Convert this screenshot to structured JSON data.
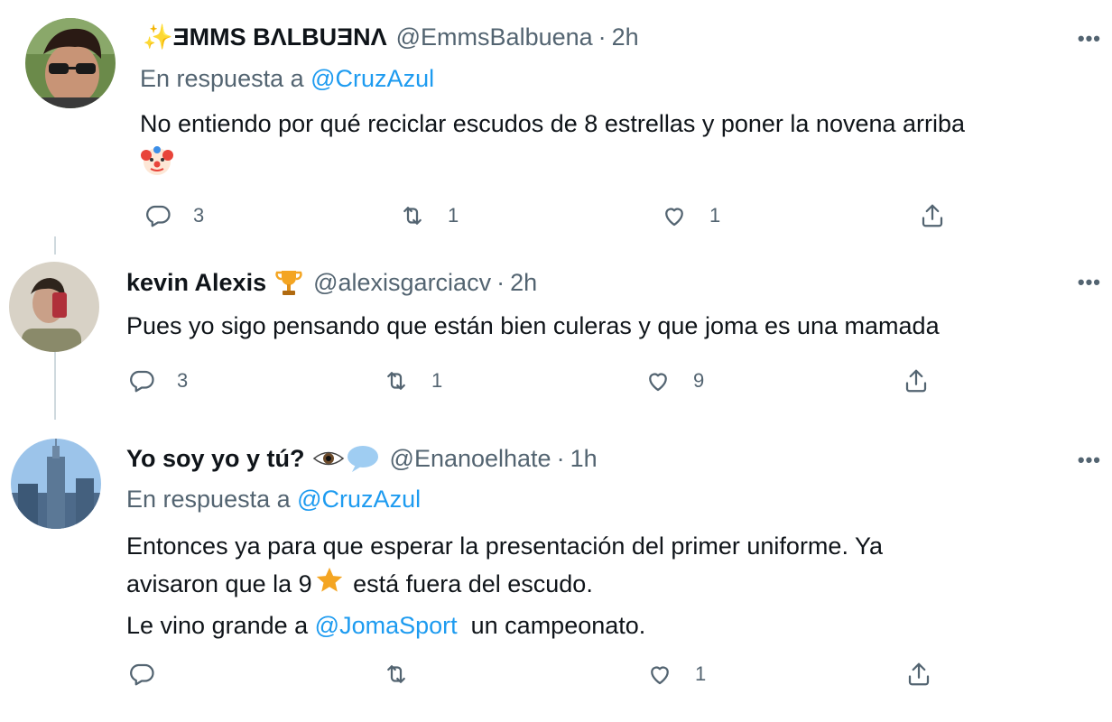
{
  "tweets": [
    {
      "display_name": "✨ƎMMS BΛLBUƎNΛ",
      "handle": "@EmmsBalbuena",
      "time": "2h",
      "replying_prefix": "En respuesta a",
      "replying_to": "@CruzAzul",
      "text_line1": "No entiendo por qué reciclar escudos de 8 estrellas y poner la novena arriba",
      "emoji": "clown-face",
      "replies": "3",
      "retweets": "1",
      "likes": "1"
    },
    {
      "display_name": "kevin Alexis",
      "name_emoji": "trophy",
      "handle": "@alexisgarciacv",
      "time": "2h",
      "text_line1": "Pues yo sigo pensando que están bien culeras y que joma es una mamada",
      "replies": "3",
      "retweets": "1",
      "likes": "9"
    },
    {
      "display_name": "Yo soy yo y tú?",
      "name_emoji": "eye-in-speech-bubble",
      "handle": "@Enanoelhate",
      "time": "1h",
      "replying_prefix": "En respuesta a",
      "replying_to": "@CruzAzul",
      "text_line1": "Entonces ya para que esperar la presentación del primer uniforme. Ya",
      "text_line2a": "avisaron que la 9",
      "text_line2b": " está fuera del escudo.",
      "text_line3a": "Le vino grande a ",
      "text_line3_mention": "@JomaSport",
      "text_line3b": "  un campeonato.",
      "replies": "",
      "retweets": "",
      "likes": "1"
    }
  ],
  "separator": "·",
  "more_label": "•••",
  "colors": {
    "accent": "#1d9bf0",
    "secondary_text": "#536471",
    "primary_text": "#0f1419",
    "star": "#f4a522"
  }
}
